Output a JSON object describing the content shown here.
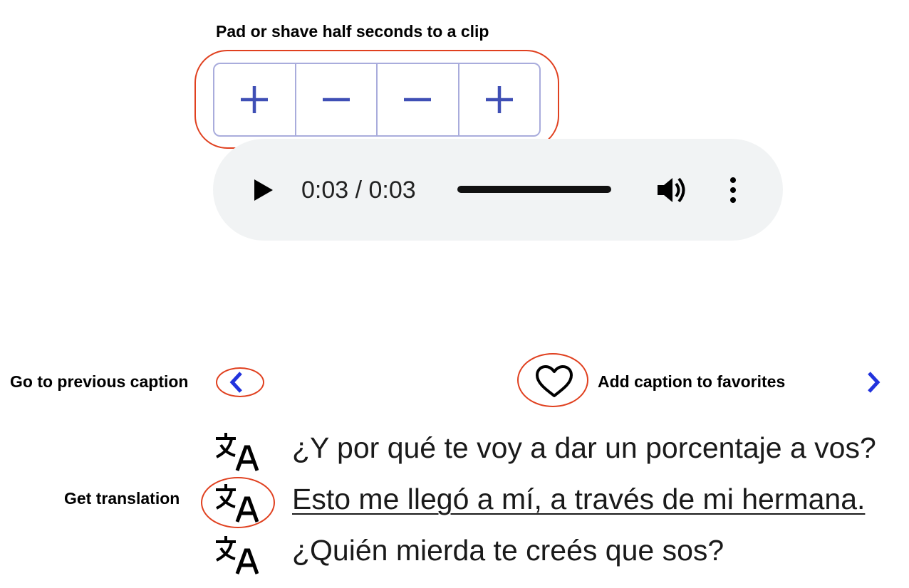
{
  "annotations": {
    "pad_shave": "Pad or shave half seconds to a clip",
    "previous_caption": "Go to previous caption",
    "favorites": "Add caption to favorites",
    "translation": "Get translation"
  },
  "pad_controls": {
    "buttons": [
      {
        "symbol": "+",
        "icon": "plus-icon"
      },
      {
        "symbol": "−",
        "icon": "minus-icon"
      },
      {
        "symbol": "−",
        "icon": "minus-icon"
      },
      {
        "symbol": "+",
        "icon": "plus-icon"
      }
    ]
  },
  "audio": {
    "time": "0:03 / 0:03",
    "progress": 1.0,
    "icons": [
      "play-icon",
      "volume-icon",
      "more-vert-icon"
    ]
  },
  "navigation": {
    "prev_icon": "chevron-left-icon",
    "next_icon": "chevron-right-icon",
    "favorite_icon": "heart-icon"
  },
  "captions": [
    {
      "text": "¿Y por qué te voy a dar un porcentaje a vos?",
      "current": false
    },
    {
      "text": "Esto me llegó a mí, a través de mi hermana.",
      "current": true
    },
    {
      "text": "¿Quién mierda te creés que sos?",
      "current": false
    }
  ],
  "colors": {
    "accent_blue": "#3f4fb5",
    "nav_blue": "#2233dd",
    "annotation_red": "#e0401f",
    "group_border": "#a9acdc",
    "player_bg": "#f1f3f4"
  }
}
